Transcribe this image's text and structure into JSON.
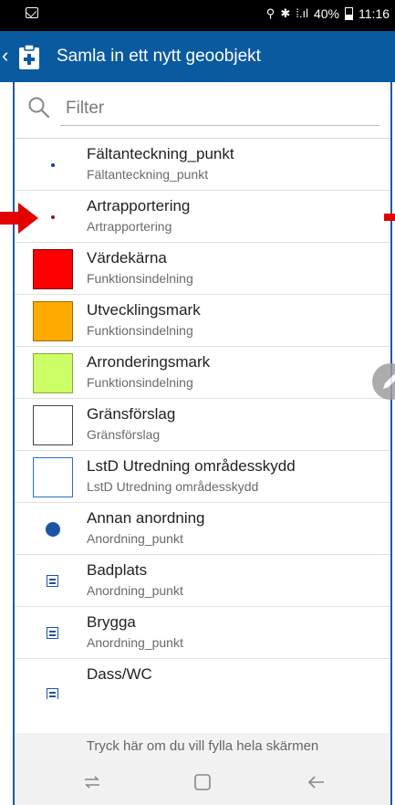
{
  "status_bar": {
    "battery": "40%",
    "time": "11:16"
  },
  "app_bar": {
    "title": "Samla in ett nytt geoobjekt"
  },
  "filter": {
    "placeholder": "Filter"
  },
  "items": [
    {
      "title": "Fältanteckning_punkt",
      "subtitle": "Fältanteckning_punkt",
      "symbol": "dot",
      "color": "#1a3f8a"
    },
    {
      "title": "Artrapportering",
      "subtitle": "Artrapportering",
      "symbol": "dot",
      "color": "#8b1a1a"
    },
    {
      "title": "Värdekärna",
      "subtitle": "Funktionsindelning",
      "symbol": "square-filled",
      "color": "#ff0000"
    },
    {
      "title": "Utvecklingsmark",
      "subtitle": "Funktionsindelning",
      "symbol": "square-filled",
      "color": "#ffaa00"
    },
    {
      "title": "Arronderingsmark",
      "subtitle": "Funktionsindelning",
      "symbol": "square-filled",
      "color": "#ccff66"
    },
    {
      "title": "Gränsförslag",
      "subtitle": "Gränsförslag",
      "symbol": "square-outline",
      "color": "#444444"
    },
    {
      "title": "LstD Utredning områdesskydd",
      "subtitle": "LstD Utredning områdesskydd",
      "symbol": "square-outline",
      "color": "#2e6dc9"
    },
    {
      "title": "Annan anordning",
      "subtitle": "Anordning_punkt",
      "symbol": "circle",
      "color": "#1c54a4"
    },
    {
      "title": "Badplats",
      "subtitle": "Anordning_punkt",
      "symbol": "mini-icon",
      "color": "#1c54a4"
    },
    {
      "title": "Brygga",
      "subtitle": "Anordning_punkt",
      "symbol": "mini-icon",
      "color": "#1c54a4"
    },
    {
      "title": "Dass/WC",
      "subtitle": "",
      "symbol": "mini-icon",
      "color": "#1c54a4"
    }
  ],
  "hint": "Tryck här om du vill fylla hela skärmen",
  "colors": {
    "app_bar": "#0a5aa0",
    "arrow": "#e00000"
  }
}
